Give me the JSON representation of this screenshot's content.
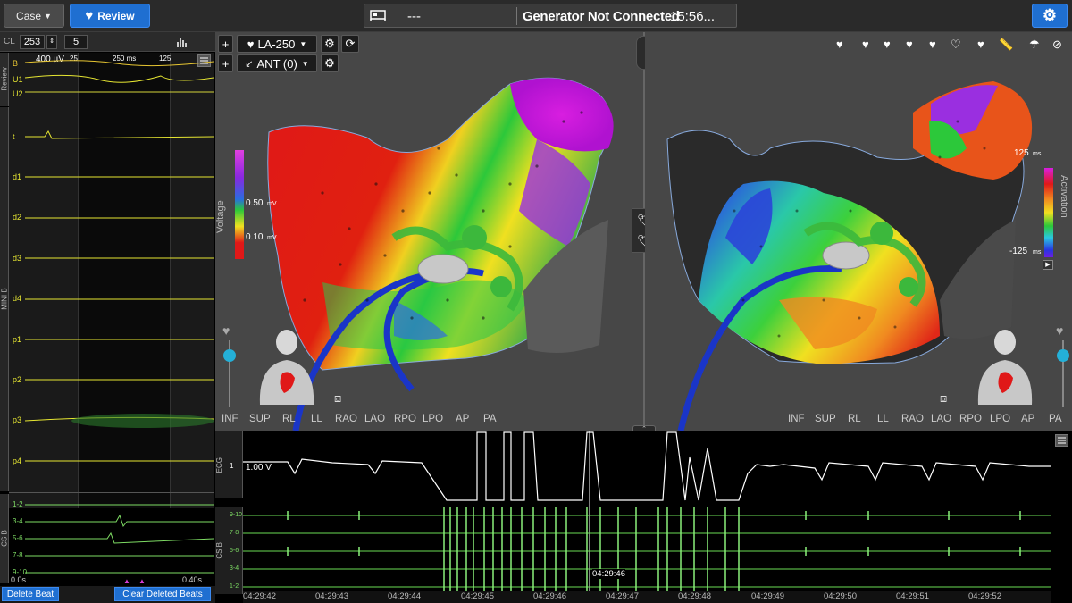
{
  "toolbar": {
    "case_label": "Case",
    "review_label": "Review",
    "status_sym": "---",
    "status_text": "Generator Not Connected",
    "time": "15:56..."
  },
  "left": {
    "cl_label": "CL",
    "cl_value": "253",
    "beats_value": "5",
    "scale": "400 µV",
    "ticks": [
      "25",
      "250 ms",
      "125"
    ],
    "review_tab": "Review",
    "minib_tab": "MINI B",
    "csb_tab": "CS B",
    "review_channels": [
      "B",
      "U1",
      "U2"
    ],
    "mini_channels": [
      "t",
      "d1",
      "d2",
      "d3",
      "d4",
      "p1",
      "p2",
      "p3",
      "p4"
    ],
    "cs_channels": [
      "1-2",
      "3-4",
      "5-6",
      "7-8",
      "9-10"
    ],
    "time_start": "0.0s",
    "time_end": "0.40s",
    "delete_beat": "Delete Beat",
    "clear_deleted": "Clear Deleted Beats"
  },
  "map": {
    "plus": "+",
    "catheter": "LA-250",
    "reference": "ANT (0)",
    "voltage_label": "Voltage",
    "voltage_high": "0.50",
    "voltage_low": "0.10",
    "voltage_unit": "mV",
    "activation_label": "Activation",
    "act_high": "125",
    "act_low": "-125",
    "act_unit": "ms",
    "views": [
      "INF",
      "SUP",
      "RL",
      "LL",
      "RAO",
      "LAO",
      "RPO",
      "LPO",
      "AP",
      "PA"
    ]
  },
  "ecg": {
    "ecg_tab": "ECG",
    "cs_tab": "CS B",
    "lead": "1",
    "scale": "1.00 V",
    "cursor_time": "04:29:46",
    "cs_channels": [
      "9-10",
      "7-8",
      "5-6",
      "3-4",
      "1-2"
    ],
    "timestamps": [
      "04:29:42",
      "04:29:43",
      "04:29:44",
      "04:29:45",
      "04:29:46",
      "04:29:47",
      "04:29:48",
      "04:29:49",
      "04:29:50",
      "04:29:51",
      "04:29:52"
    ]
  }
}
